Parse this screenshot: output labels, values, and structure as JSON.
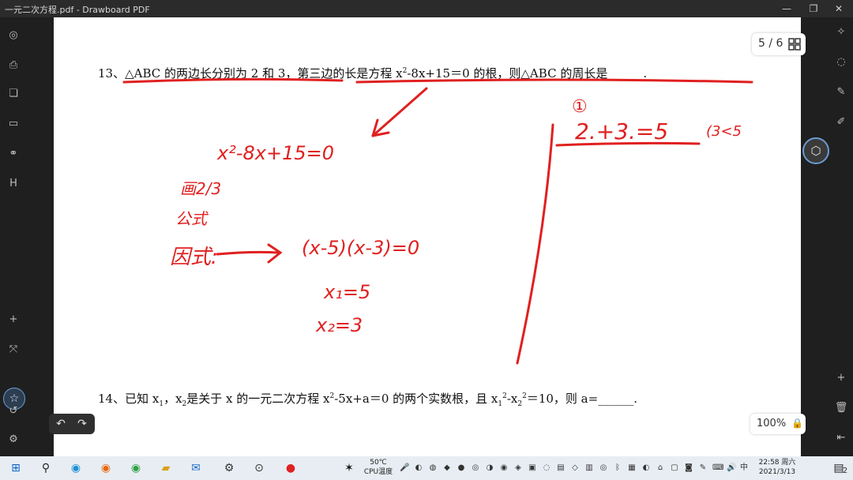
{
  "window": {
    "title": "一元二次方程.pdf - Drawboard PDF"
  },
  "page_indicator": {
    "label": "5 / 6"
  },
  "zoom": {
    "label": "100%"
  },
  "problems": {
    "p13": {
      "pre": "13、△ABC 的两边长分别为 2 和 3，第三边的长是方程 x",
      "sup": "2",
      "post": "-8x+15＝0 的根，则△ABC 的周长是______."
    },
    "p14": {
      "a": "14、已知 x",
      "s1": "1",
      "b": "，x",
      "s2": "2",
      "c": "是关于 x 的一元二次方程 x",
      "e2": "2",
      "d": "-5x+a＝0 的两个实数根，且 x",
      "s3": "1",
      "e3": "2",
      "e": "-x",
      "s4": "2",
      "e4": "2",
      "f": "＝10，则 a=______."
    }
  },
  "handwriting": {
    "equation": "x²-8x+15=0",
    "method1": "画2/3",
    "method2": "公式",
    "method3": "因式:",
    "factored": "(x-5)(x-3)=0",
    "root1": "x₁=5",
    "root2": "x₂=3",
    "circle_num": "①",
    "sum": "2.+3.=5",
    "sum_note": "(3<5"
  },
  "taskbar": {
    "temp": "50℃",
    "cpu": "CPU温度",
    "time": "22:58 周六",
    "date": "2021/3/13",
    "notif": "2"
  },
  "colors": {
    "ink": "#e02020",
    "page": "#ffffff",
    "chrome": "#1f1f1f",
    "accent": "#6b9bd1"
  }
}
